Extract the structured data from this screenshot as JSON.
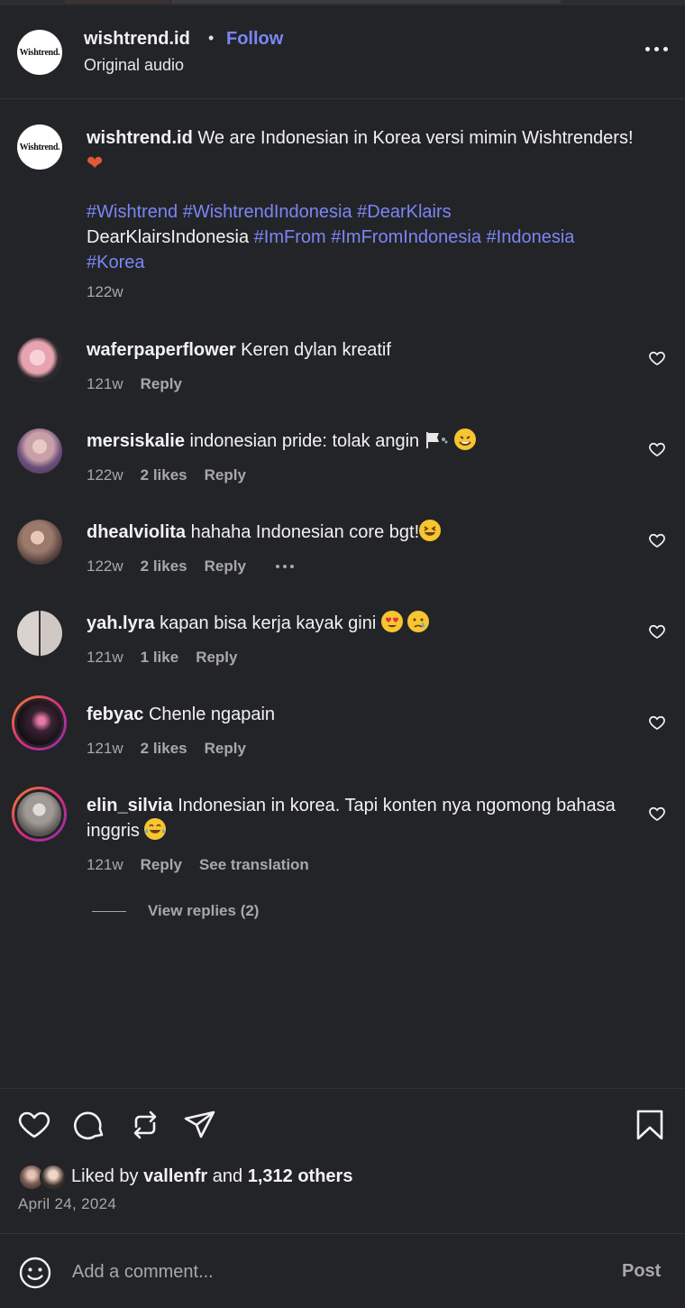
{
  "header": {
    "username": "wishtrend.id",
    "separator": "•",
    "follow_label": "Follow",
    "subtitle": "Original audio",
    "logo_text": "Wishtrend."
  },
  "caption": {
    "username": "wishtrend.id",
    "text": "We are Indonesian in Korea versi mimin Wishtrenders!",
    "emoji": "heart-emoji",
    "tags_line1": [
      "#Wishtrend",
      "#WishtrendIndonesia",
      "#DearKlairs"
    ],
    "plain_word": "DearKlairsIndonesia",
    "tags_line2": [
      "#ImFrom",
      "#ImFromIndonesia",
      "#Indonesia"
    ],
    "tags_line3": [
      "#Korea"
    ],
    "time": "122w"
  },
  "comments": [
    {
      "username": "waferpaperflower",
      "text": "Keren dylan kreatif",
      "time": "121w",
      "likes": "",
      "reply": "Reply"
    },
    {
      "username": "mersiskalie",
      "text": "indonesian pride: tolak angin",
      "time": "122w",
      "likes": "2 likes",
      "reply": "Reply"
    },
    {
      "username": "dhealviolita",
      "text": "hahaha Indonesian core bgt!",
      "time": "122w",
      "likes": "2 likes",
      "reply": "Reply"
    },
    {
      "username": "yah.lyra",
      "text": "kapan bisa kerja kayak gini",
      "time": "121w",
      "likes": "1 like",
      "reply": "Reply"
    },
    {
      "username": "febyac",
      "text": "Chenle ngapain",
      "time": "121w",
      "likes": "2 likes",
      "reply": "Reply"
    },
    {
      "username": "elin_silvia",
      "text": "Indonesian in korea. Tapi konten nya ngomong bahasa inggris",
      "time": "121w",
      "likes": "",
      "reply": "Reply",
      "translate": "See translation"
    }
  ],
  "view_replies": "View replies (2)",
  "likes": {
    "prefix": "Liked by",
    "user": "vallenfr",
    "and": "and",
    "others": "1,312 others"
  },
  "date": "April 24, 2024",
  "composer": {
    "placeholder": "Add a comment...",
    "post_label": "Post"
  },
  "colors": {
    "background": "#232427",
    "accent": "#7b86f5",
    "muted": "#a8a8a8"
  }
}
